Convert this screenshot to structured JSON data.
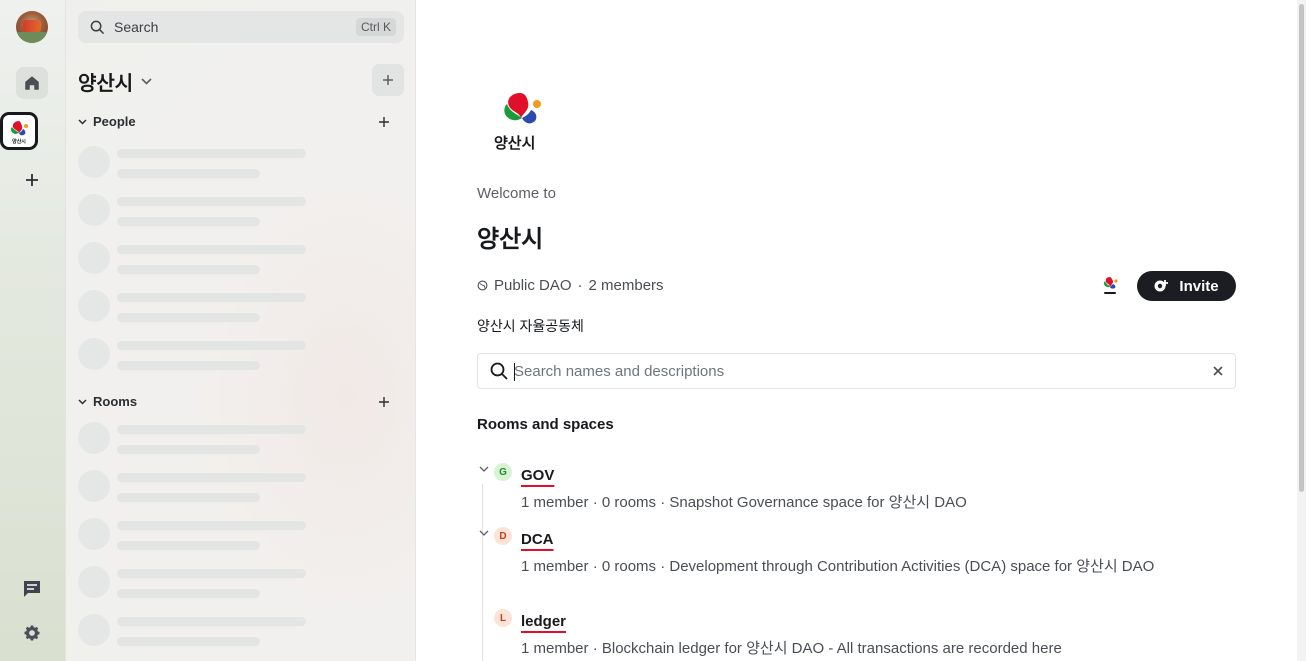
{
  "rail": {
    "home_tooltip": "Home",
    "space_logo_text": "양산시"
  },
  "panel": {
    "search_label": "Search",
    "search_shortcut": "Ctrl K",
    "space_name": "양산시",
    "sections": {
      "people": "People",
      "rooms": "Rooms"
    }
  },
  "main": {
    "logo_text": "양산시",
    "welcome": "Welcome to",
    "title": "양산시",
    "visibility": "Public DAO",
    "members": "2 members",
    "invite_label": "Invite",
    "topic": "양산시 자율공동체",
    "filter_placeholder": "Search names and descriptions",
    "rooms_title": "Rooms and spaces",
    "rooms": [
      {
        "badge": "G",
        "name": "GOV",
        "desc": "1 member · 0 rooms · Snapshot Governance space for 양산시 DAO",
        "badge_bg": "#d8f3d4",
        "badge_fg": "#1f8a2e",
        "collapsible": true
      },
      {
        "badge": "D",
        "name": "DCA",
        "desc": "1 member · 0 rooms · Development through Contribution Activities (DCA) space for 양산시 DAO",
        "badge_bg": "#fbe3d8",
        "badge_fg": "#c2411a",
        "collapsible": true
      },
      {
        "badge": "L",
        "name": "ledger",
        "desc": "1 member · Blockchain ledger for 양산시 DAO - All transactions are recorded here",
        "badge_bg": "#fbe3d8",
        "badge_fg": "#c2411a",
        "collapsible": false
      }
    ]
  },
  "colors": {
    "accent_dark": "#1b1d22",
    "underline_red": "#e0102a"
  }
}
